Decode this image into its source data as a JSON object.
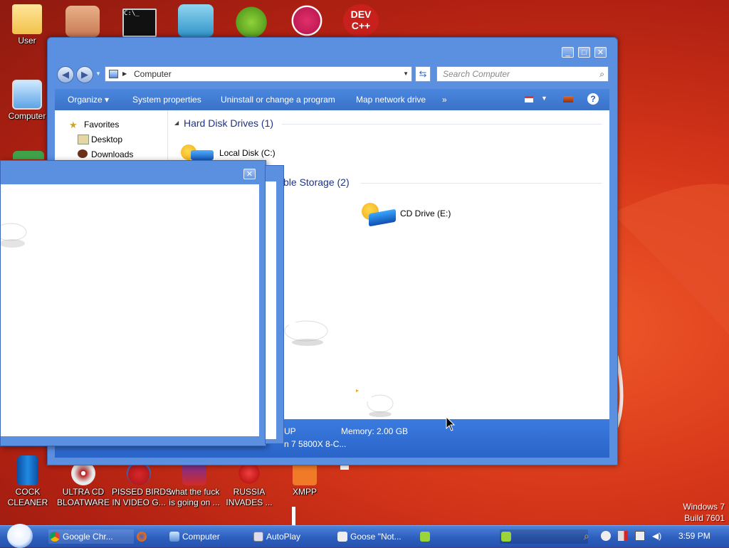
{
  "desktop_icons": [
    {
      "id": "user",
      "label": "User"
    },
    {
      "id": "computer",
      "label": "Computer"
    },
    {
      "id": "cock-cleaner",
      "label": "COCK\nCLEANER"
    },
    {
      "id": "ultra-cd",
      "label": "ULTRA CD\nBLOATWARE"
    },
    {
      "id": "pissed-birds",
      "label": "PISSED BIRDS\nIN VIDEO G..."
    },
    {
      "id": "what-the",
      "label": "what the fuck\nis going on ..."
    },
    {
      "id": "russia",
      "label": "RUSSIA\nINVADES ..."
    },
    {
      "id": "xmpp",
      "label": "XMPP"
    }
  ],
  "top_icons": {
    "dev_label": "DEV\nC++"
  },
  "explorer": {
    "address": "Computer",
    "search_placeholder": "Search Computer",
    "commands": [
      "Organize",
      "System properties",
      "Uninstall or change a program",
      "Map network drive",
      "»"
    ],
    "nav": [
      {
        "label": "Favorites"
      },
      {
        "label": "Desktop"
      },
      {
        "label": "Downloads"
      }
    ],
    "groups": [
      {
        "title": "Hard Disk Drives (1)",
        "drives": [
          {
            "label": "Local Disk (C:)"
          }
        ]
      },
      {
        "title": "ble Storage (2)",
        "drives": [
          {
            "label": "CD Drive (E:)"
          }
        ]
      }
    ],
    "details": {
      "left_top": "UP",
      "memory": "Memory: 2.00 GB",
      "left_bottom": "n 7 5800X 8-C..."
    }
  },
  "taskbar": {
    "items": [
      {
        "label": "Google Chr..."
      },
      {
        "label": "Computer"
      },
      {
        "label": "AutoPlay"
      },
      {
        "label": "Goose \"Not..."
      }
    ],
    "clock": "3:59 PM"
  },
  "watermark": {
    "line1": "Windows 7",
    "line2": "Build 7601"
  },
  "colors": {
    "accent": "#3b72c8",
    "desktop": "#d8381a",
    "taskbar": "#2d5fbf"
  }
}
